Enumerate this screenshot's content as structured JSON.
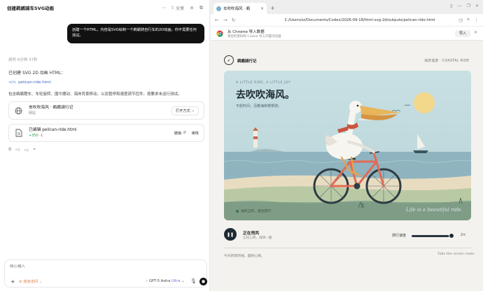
{
  "chat": {
    "title": "创建鹈鹕骑车SVG动画",
    "share_label": "分享",
    "user_message": "创建一个HTML，内容是SVG绘制一个鹈鹕骑自行车的2D动画，你不需要任何测试。",
    "elapsed": "用时 6分钟 37秒",
    "done_text": "已创建 SVG 2D 动画 HTML：",
    "file_link": "pelican-ride.html",
    "description": "包含鹈鹕蹬车、车轮旋转、围巾摆动、海岸背景移动，以及暂停和速度调节控件。按要求未运行测试。",
    "card_preview": {
      "title": "去吹吹海风 · 鹈鹕骑行记",
      "subtitle": "网站",
      "open_label": "打开方式"
    },
    "card_edit": {
      "title": "已编辑 pelican-ride.html",
      "added": "+350",
      "removed": "-1",
      "undo_label": "撤销",
      "review_label": "审核"
    },
    "composer": {
      "placeholder": "随心输入",
      "access_label": "完全访问",
      "model_name": "GPT-5 Astra",
      "model_tier": "Ultra"
    }
  },
  "browser": {
    "tab_title": "去吹吹海风 · 鹈",
    "url": "C:/Users/zz/Documents/Codex/2026-09-18/html-svg-2d/outputs/pelican-ride.html",
    "import_bar": {
      "title": "从 Chrome 导入数据",
      "subtitle": "将您的密码和 Cookie 导入内置浏览器",
      "button_label": "导入"
    }
  },
  "page": {
    "brand_name": "鹈鹕骑行记",
    "brand_tag": "海岸漫游 · COASTAL RIDE",
    "hero_eyebrow": "A LITTLE RIDE, A LITTLE JOY",
    "hero_title": "去吹吹海风。",
    "hero_subtitle": "不赶时间，沿着海岸慢慢骑。",
    "hero_chip": "海风正好，适合前行",
    "hero_slogan": "Life is a beautiful ride.",
    "status_title": "正在兜风",
    "status_sub": "让轮心转，再转一圈",
    "speed_label": "骑行速度",
    "speed_value": "2×",
    "speed_level_fraction": 0.95,
    "footer_left": "今天的目的地，是好心情。",
    "footer_right": "Take the scenic route."
  },
  "colors": {
    "sky": "#bcd7dc",
    "sea": "#8fb4bf",
    "sand": "#e8dcc0",
    "sun": "#f3d78a",
    "bike_frame": "#e06b55",
    "accent_link": "#3a63c4",
    "access_orange": "#d9712a"
  }
}
